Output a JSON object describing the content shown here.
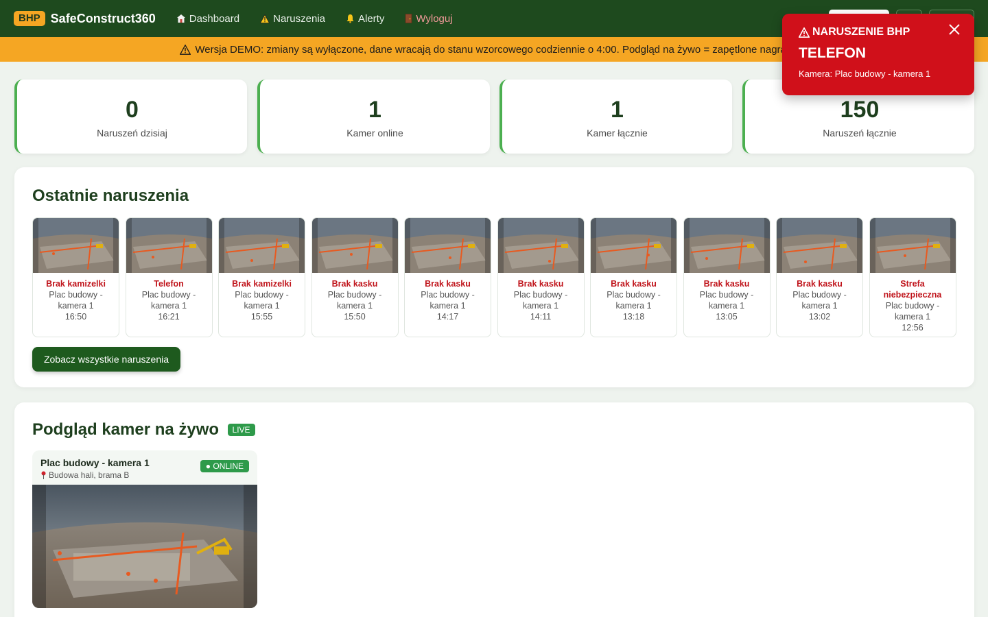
{
  "navbar": {
    "badge": "BHP",
    "brand": "SafeConstruct360",
    "links": [
      {
        "label": "Dashboard",
        "icon": "home-icon"
      },
      {
        "label": "Naruszenia",
        "icon": "warning-icon"
      },
      {
        "label": "Alerty",
        "icon": "bell-icon"
      },
      {
        "label": "Wyloguj",
        "icon": "door-icon"
      }
    ],
    "user": "demo"
  },
  "banner": {
    "text": "Wersja DEMO: zmiany są wyłączone, dane wracają do stanu wzorcowego codziennie o 4:00. Podgląd na żywo = zapętlone nagranie z"
  },
  "stats": [
    {
      "value": "0",
      "label": "Naruszeń dzisiaj"
    },
    {
      "value": "1",
      "label": "Kamer online"
    },
    {
      "value": "1",
      "label": "Kamer łącznie"
    },
    {
      "value": "150",
      "label": "Naruszeń łącznie"
    }
  ],
  "recent": {
    "title": "Ostatnie naruszenia",
    "items": [
      {
        "type": "Brak kamizelki",
        "camera": "Plac budowy - kamera 1",
        "time": "16:50"
      },
      {
        "type": "Telefon",
        "camera": "Plac budowy - kamera 1",
        "time": "16:21"
      },
      {
        "type": "Brak kamizelki",
        "camera": "Plac budowy - kamera 1",
        "time": "15:55"
      },
      {
        "type": "Brak kasku",
        "camera": "Plac budowy - kamera 1",
        "time": "15:50"
      },
      {
        "type": "Brak kasku",
        "camera": "Plac budowy - kamera 1",
        "time": "14:17"
      },
      {
        "type": "Brak kasku",
        "camera": "Plac budowy - kamera 1",
        "time": "14:11"
      },
      {
        "type": "Brak kasku",
        "camera": "Plac budowy - kamera 1",
        "time": "13:18"
      },
      {
        "type": "Brak kasku",
        "camera": "Plac budowy - kamera 1",
        "time": "13:05"
      },
      {
        "type": "Brak kasku",
        "camera": "Plac budowy - kamera 1",
        "time": "13:02"
      },
      {
        "type": "Strefa niebezpieczna",
        "camera": "Plac budowy - kamera 1",
        "time": "12:56"
      }
    ],
    "button": "Zobacz wszystkie naruszenia"
  },
  "live": {
    "title": "Podgląd kamer na żywo",
    "badge": "LIVE",
    "camera": {
      "name": "Plac budowy - kamera 1",
      "location": "Budowa hali, brama B",
      "status": "● ONLINE"
    }
  },
  "toast": {
    "title": "NARUSZENIE BHP",
    "subtitle": "TELEFON",
    "camera": "Kamera: Plac budowy - kamera 1"
  },
  "colors": {
    "navbar": "#1e4a1e",
    "accent": "#f5a623",
    "danger": "#d0101a",
    "success": "#2e9a4a"
  }
}
